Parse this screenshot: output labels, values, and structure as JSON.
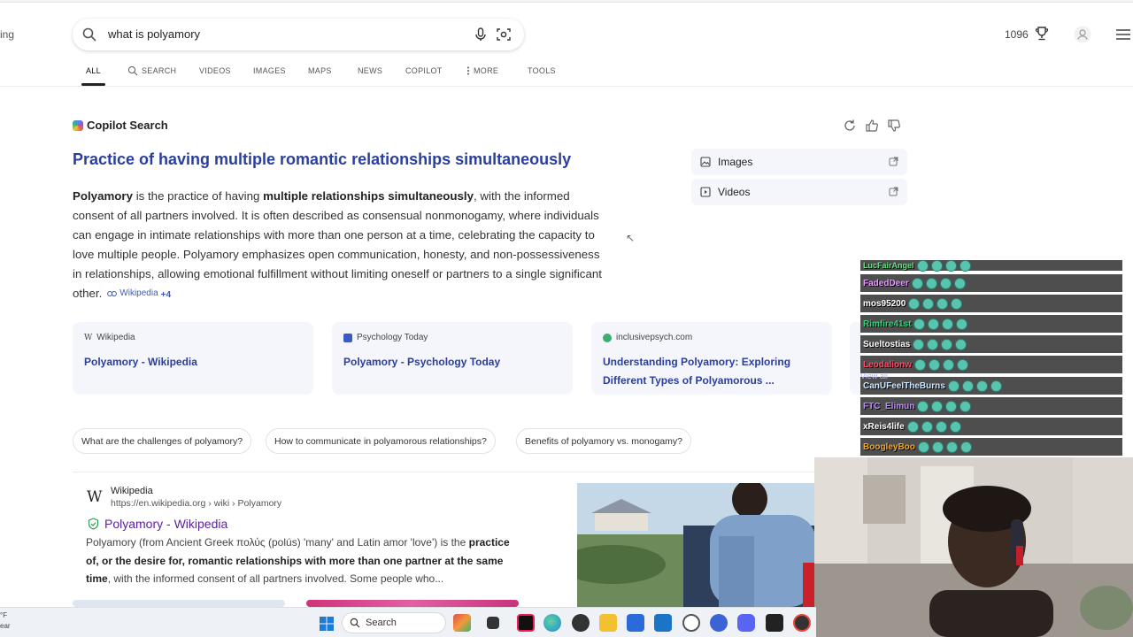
{
  "browser": {
    "cutoff_left_text": "ing",
    "search": {
      "query": "what is polyamory",
      "placeholder": ""
    },
    "rewards_points": "1096"
  },
  "tabs": [
    {
      "label": "ALL",
      "active": true
    },
    {
      "label": "SEARCH",
      "icon": "copilot-search-icon"
    },
    {
      "label": "VIDEOS"
    },
    {
      "label": "IMAGES"
    },
    {
      "label": "MAPS"
    },
    {
      "label": "NEWS"
    },
    {
      "label": "COPILOT"
    },
    {
      "label": "MORE",
      "icon": "more-vertical-icon"
    },
    {
      "label": "TOOLS"
    }
  ],
  "copilot": {
    "badge": "Copilot Search",
    "title": "Practice of having multiple romantic relationships simultaneously",
    "answer": {
      "p1_bold": "Polyamory",
      "p2": " is the practice of having ",
      "p3_bold": "multiple relationships simultaneously",
      "p4": ", with the informed consent of all partners involved. It is often described as consensual nonmonogamy, where individuals can engage in intimate relationships with more than one person at a time, celebrating the capacity to love multiple people. Polyamory emphasizes open communication, honesty, and non-possessiveness in relationships, allowing emotional fulfillment without limiting oneself or partners to a single significant other.",
      "cite_label": "Wikipedia",
      "cite_more": "+4"
    },
    "side_links": [
      {
        "label": "Images",
        "icon": "image-icon"
      },
      {
        "label": "Videos",
        "icon": "video-icon"
      }
    ],
    "sources": [
      {
        "site": "Wikipedia",
        "title": "Polyamory - Wikipedia",
        "color": "#ffffff"
      },
      {
        "site": "Psychology Today",
        "title": "Polyamory - Psychology Today",
        "color": "#3b5ac8"
      },
      {
        "site": "inclusivepsych.com",
        "title": "Understanding Polyamory: Exploring Different Types of Polyamorous ...",
        "color": "#3cae72"
      }
    ],
    "related": [
      "What are the challenges of polyamory?",
      "How to communicate in polyamorous relationships?",
      "Benefits of polyamory vs. monogamy?"
    ]
  },
  "result": {
    "site_name": "Wikipedia",
    "url": "https://en.wikipedia.org › wiki › Polyamory",
    "title": "Polyamory - Wikipedia",
    "snippet": {
      "s1": "Polyamory (from Ancient Greek πολύς (polús) 'many' and Latin amor 'love') is the ",
      "s2_bold": "practice of, or the desire for, romantic relationships with more than one partner at the same time",
      "s3": ", with the informed consent of all partners involved. Some people who..."
    }
  },
  "stream_chat": {
    "view_all": "View all",
    "messages": [
      {
        "name": "LucFairAngel",
        "color": "#6de38d",
        "emotes": 4
      },
      {
        "name": "FadedDeer",
        "color": "#e79bff",
        "emotes": 4
      },
      {
        "name": "mos95200",
        "color": "#ffffff",
        "emotes": 4
      },
      {
        "name": "Rimfire41st",
        "color": "#33d17a",
        "emotes": 4
      },
      {
        "name": "Sueltostias",
        "color": "#ffffff",
        "emotes": 4
      },
      {
        "name": "Leodalionw",
        "color": "#ff4d6d",
        "emotes": 4
      },
      {
        "name": "CanUFeelTheBurns",
        "color": "#cfe8ff",
        "emotes": 4
      },
      {
        "name": "FTC_Elimun",
        "color": "#b98cff",
        "emotes": 4
      },
      {
        "name": "xReis4life",
        "color": "#ffffff",
        "emotes": 4
      },
      {
        "name": "BoogleyBoo",
        "color": "#f5a623",
        "emotes": 4
      }
    ]
  },
  "taskbar": {
    "weather_line1": "°F",
    "weather_line2": "ear",
    "search_label": "Search",
    "apps": [
      {
        "name": "maps-app-icon",
        "color": "#e14b4b"
      },
      {
        "name": "files-app-icon",
        "color": "#333333"
      },
      {
        "name": "tiktok-icon",
        "color": "#111111"
      },
      {
        "name": "edge-icon",
        "color": "#1fa3d6"
      },
      {
        "name": "chrome-icon",
        "color": "#444444"
      },
      {
        "name": "file-explorer-icon",
        "color": "#f4c032"
      },
      {
        "name": "store-icon",
        "color": "#2b6ad9"
      },
      {
        "name": "outlook-icon",
        "color": "#1c74c9"
      },
      {
        "name": "chatgpt-icon",
        "color": "#555555"
      },
      {
        "name": "copilot-app-icon",
        "color": "#3c63d6"
      },
      {
        "name": "discord-icon",
        "color": "#5865f2"
      },
      {
        "name": "capcut-icon",
        "color": "#222222"
      },
      {
        "name": "obs-icon",
        "color": "#333333"
      }
    ]
  }
}
